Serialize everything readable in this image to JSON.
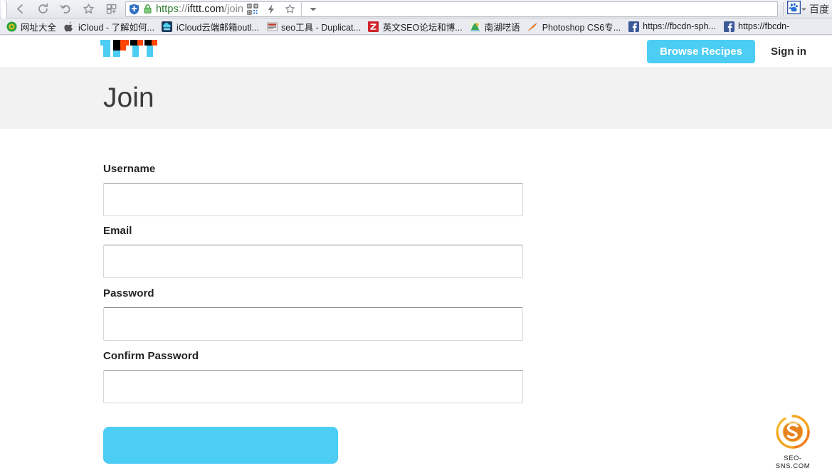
{
  "browser": {
    "nav_icons": [
      {
        "name": "back-icon",
        "glyph": "back"
      },
      {
        "name": "reload-icon",
        "glyph": "reload"
      },
      {
        "name": "history-back-icon",
        "glyph": "undo"
      },
      {
        "name": "bookmark-star-icon",
        "glyph": "star"
      },
      {
        "name": "apps-grid-icon",
        "glyph": "grid"
      }
    ],
    "address_bar": {
      "security_icon": "lock-icon",
      "shield_icon": "shield-icon",
      "scheme": "https",
      "separator": "://",
      "host": "ifttt.com",
      "path": "/join",
      "full_url": "https://ifttt.com/join"
    },
    "omnibox_icons": [
      {
        "name": "qr-code-icon"
      },
      {
        "name": "lightning-icon"
      },
      {
        "name": "favorite-star-icon"
      },
      {
        "name": "dropdown-caret-icon"
      }
    ],
    "extension": {
      "name": "baidu-extension",
      "icon": "paw-icon",
      "label": "百度"
    },
    "bookmarks": [
      {
        "icon": "hao123-icon",
        "label": "网址大全",
        "color": "#2aa13c"
      },
      {
        "icon": "apple-icon",
        "label": "iCloud - 了解如何...",
        "color": "#555555"
      },
      {
        "icon": "icloud-mail-icon",
        "label": "iCloud云端邮箱outl...",
        "color": "#1b6fa8"
      },
      {
        "icon": "seo-tool-icon",
        "label": "seo工具 - Duplicat...",
        "color": "#b03a2e"
      },
      {
        "icon": "zhihu-z-icon",
        "label": "英文SEO论坛和博...",
        "color": "#d0232b"
      },
      {
        "icon": "nanhu-icon",
        "label": "南湖呓语",
        "color": "#3aa655"
      },
      {
        "icon": "photoshop-icon",
        "label": "Photoshop CS6专...",
        "color": "#e2711d"
      },
      {
        "icon": "facebook-icon",
        "label": "https://fbcdn-sph...",
        "color": "#3b5998"
      },
      {
        "icon": "facebook-icon",
        "label": "https://fbcdn-",
        "color": "#3b5998"
      }
    ]
  },
  "site": {
    "logo": {
      "name": "ifttt-logo",
      "alt": "IFTTT",
      "colors": {
        "cyan": "#4ccdf4",
        "orange": "#ff4500",
        "black": "#000000"
      }
    },
    "nav": {
      "browse_recipes_label": "Browse Recipes",
      "sign_in_label": "Sign in"
    },
    "hero": {
      "title": "Join"
    },
    "form": {
      "fields": [
        {
          "name": "username",
          "label": "Username",
          "value": "",
          "placeholder": "",
          "type": "text"
        },
        {
          "name": "email",
          "label": "Email",
          "value": "",
          "placeholder": "",
          "type": "text"
        },
        {
          "name": "password",
          "label": "Password",
          "value": "",
          "placeholder": "",
          "type": "password"
        },
        {
          "name": "confirm-password",
          "label": "Confirm Password",
          "value": "",
          "placeholder": "",
          "type": "password"
        }
      ],
      "submit_label": ""
    },
    "accent_color": "#4ccdf4",
    "hero_bg_color": "#f2f2f2"
  },
  "watermark": {
    "name": "seo-sns-watermark",
    "text": "SEO-SNS.COM"
  }
}
